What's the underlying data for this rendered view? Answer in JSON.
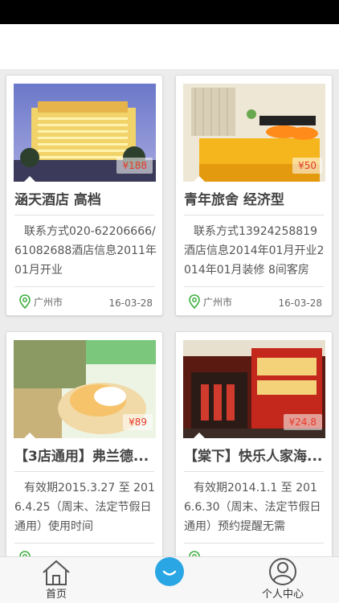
{
  "cards": [
    {
      "title": "涵天酒店 高档",
      "desc": "联系方式020-62206666/61082688酒店信息2011年01月开业",
      "location": "广州市",
      "date": "16-03-28",
      "price": "¥188"
    },
    {
      "title": "青年旅舍 经济型",
      "desc": "联系方式13924258819酒店信息2014年01月开业2014年01月装修 8间客房",
      "location": "广州市",
      "date": "16-03-28",
      "price": "¥50"
    },
    {
      "title": "【3店通用】弗兰德...",
      "desc": "有效期2015.3.27 至 2016.4.25（周末、法定节假日通用）使用时间",
      "location": "",
      "date": "",
      "price": "¥89"
    },
    {
      "title": "【棠下】快乐人家海...",
      "desc": "有效期2014.1.1 至 2016.6.30（周末、法定节假日通用）预约提醒无需",
      "location": "",
      "date": "",
      "price": "¥24.8"
    }
  ],
  "tabs": {
    "home": "首页",
    "profile": "个人中心"
  },
  "colors": {
    "accent": "#2aa6e5",
    "price": "#e63a2a",
    "location_icon": "#3dae3f"
  },
  "icons": [
    "home-icon",
    "user-icon",
    "location-pin-icon"
  ]
}
